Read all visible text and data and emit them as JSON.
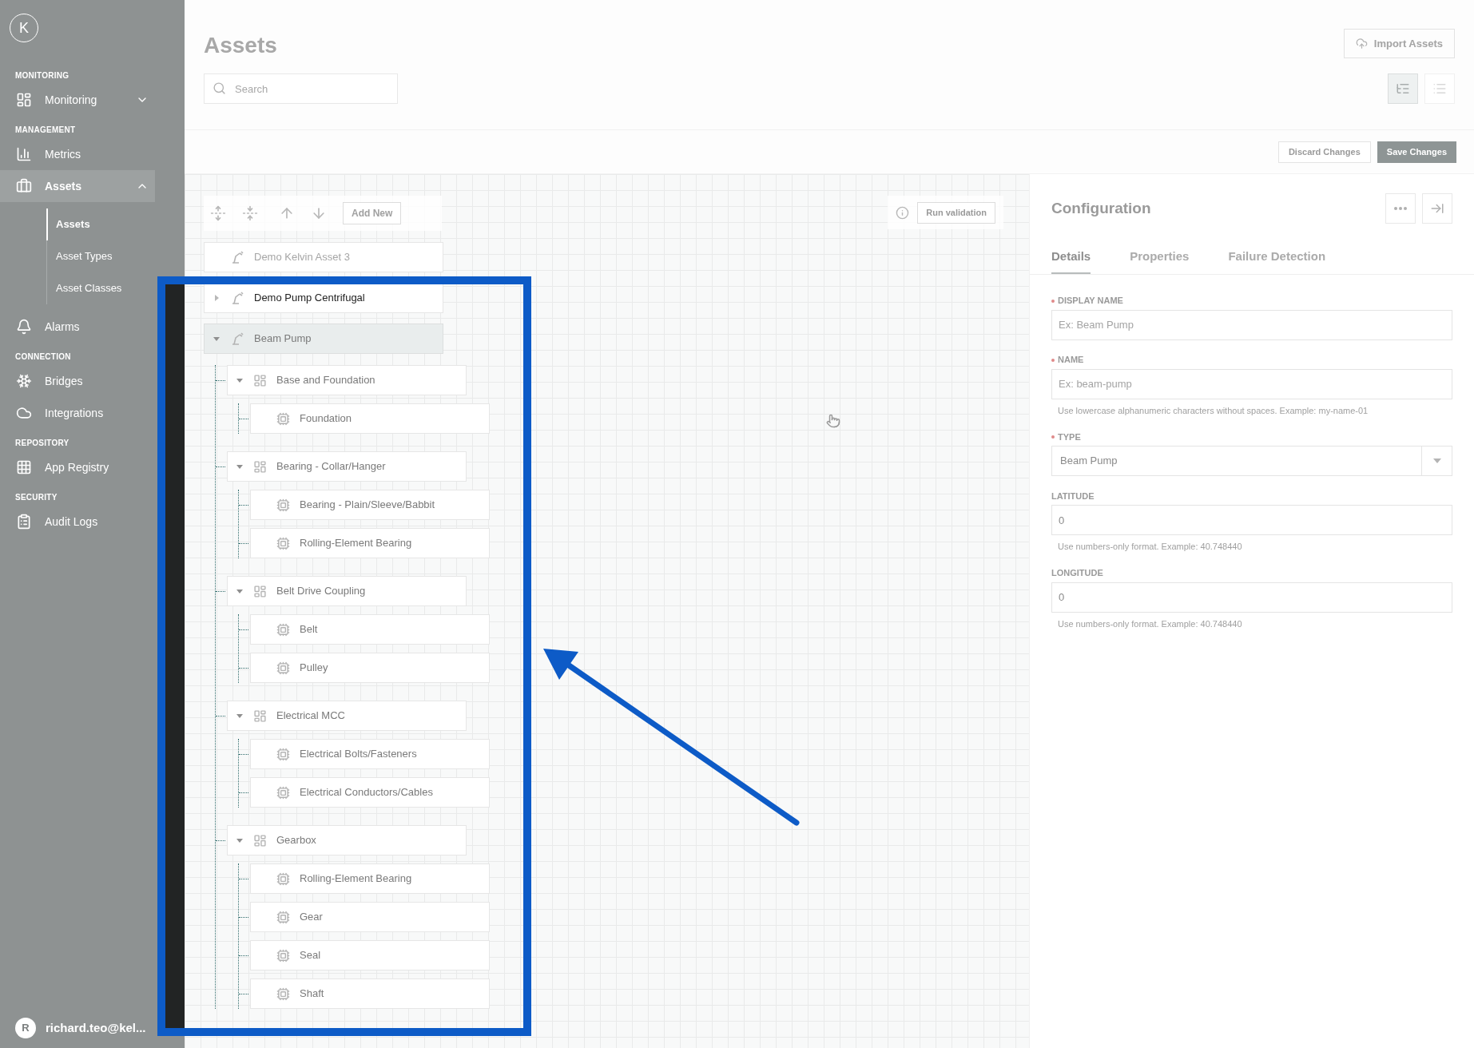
{
  "sidebar": {
    "logo": "K",
    "sections": [
      {
        "title": "MONITORING",
        "items": [
          {
            "label": "Monitoring",
            "selected": false,
            "expanded": false
          }
        ]
      },
      {
        "title": "MANAGEMENT",
        "items": [
          {
            "label": "Metrics",
            "selected": false
          },
          {
            "label": "Assets",
            "selected": true,
            "expanded": true,
            "children": [
              {
                "label": "Assets",
                "selected": true
              },
              {
                "label": "Asset Types",
                "selected": false
              },
              {
                "label": "Asset Classes",
                "selected": false
              }
            ]
          },
          {
            "label": "Alarms",
            "selected": false
          }
        ]
      },
      {
        "title": "CONNECTION",
        "items": [
          {
            "label": "Bridges",
            "selected": false
          },
          {
            "label": "Integrations",
            "selected": false
          }
        ]
      },
      {
        "title": "REPOSITORY",
        "items": [
          {
            "label": "App Registry",
            "selected": false
          }
        ]
      },
      {
        "title": "SECURITY",
        "items": [
          {
            "label": "Audit Logs",
            "selected": false
          }
        ]
      }
    ],
    "user": {
      "initial": "R",
      "name": "richard.teo@kel..."
    }
  },
  "header": {
    "title": "Assets",
    "import_button": "Import Assets",
    "search": {
      "placeholder": "Search"
    },
    "view_modes": [
      {
        "kind": "tree",
        "selected": true
      },
      {
        "kind": "list",
        "selected": false
      }
    ]
  },
  "actions": [
    {
      "label": "Discard Changes",
      "kind": "secondary"
    },
    {
      "label": "Save Changes",
      "kind": "primary"
    }
  ],
  "canvas": {
    "add_button": "Add New",
    "validate_button": "Run validation",
    "tree": [
      {
        "label": "Demo Kelvin Asset 3",
        "kind": "asset",
        "selected": false,
        "dim": true
      },
      {
        "label": "Demo Pump Centrifugal",
        "kind": "asset",
        "selected": false,
        "expanded": false
      },
      {
        "label": "Beam Pump",
        "kind": "asset",
        "selected": true,
        "expanded": true,
        "children": [
          {
            "label": "Base and Foundation",
            "kind": "component",
            "selected": false,
            "expanded": true,
            "children": [
              {
                "label": "Foundation",
                "kind": "part",
                "selected": false
              }
            ]
          },
          {
            "label": "Bearing - Collar/Hanger",
            "kind": "component",
            "selected": false,
            "expanded": true,
            "children": [
              {
                "label": "Bearing - Plain/Sleeve/Babbit",
                "kind": "part",
                "selected": false
              },
              {
                "label": "Rolling-Element Bearing",
                "kind": "part",
                "selected": false
              }
            ]
          },
          {
            "label": "Belt Drive Coupling",
            "kind": "component",
            "selected": false,
            "expanded": true,
            "children": [
              {
                "label": "Belt",
                "kind": "part",
                "selected": false
              },
              {
                "label": "Pulley",
                "kind": "part",
                "selected": false
              }
            ]
          },
          {
            "label": "Electrical MCC",
            "kind": "component",
            "selected": false,
            "expanded": true,
            "children": [
              {
                "label": "Electrical Bolts/Fasteners",
                "kind": "part",
                "selected": false
              },
              {
                "label": "Electrical Conductors/Cables",
                "kind": "part",
                "selected": false
              }
            ]
          },
          {
            "label": "Gearbox",
            "kind": "component",
            "selected": false,
            "expanded": true,
            "children": [
              {
                "label": "Rolling-Element Bearing",
                "kind": "part",
                "selected": false
              },
              {
                "label": "Gear",
                "kind": "part",
                "selected": false
              },
              {
                "label": "Seal",
                "kind": "part",
                "selected": false
              },
              {
                "label": "Shaft",
                "kind": "part",
                "selected": false
              }
            ]
          }
        ]
      }
    ]
  },
  "config": {
    "title": "Configuration",
    "tabs": [
      {
        "label": "Details",
        "selected": true
      },
      {
        "label": "Properties",
        "selected": false
      },
      {
        "label": "Failure Detection",
        "selected": false
      }
    ],
    "fields": [
      {
        "label": "DISPLAY NAME",
        "required": true,
        "kind": "text",
        "placeholder": "Ex: Beam Pump"
      },
      {
        "label": "NAME",
        "required": true,
        "kind": "text",
        "placeholder": "Ex: beam-pump",
        "hint": "Use lowercase alphanumeric characters without spaces. Example: my-name-01"
      },
      {
        "label": "TYPE",
        "required": true,
        "kind": "select",
        "value": "Beam Pump"
      },
      {
        "label": "LATITUDE",
        "required": false,
        "kind": "text",
        "value": "0",
        "hint": "Use numbers-only format. Example: 40.748440"
      },
      {
        "label": "LONGITUDE",
        "required": false,
        "kind": "text",
        "value": "0",
        "hint": "Use numbers-only format. Example: 40.748440"
      }
    ]
  }
}
